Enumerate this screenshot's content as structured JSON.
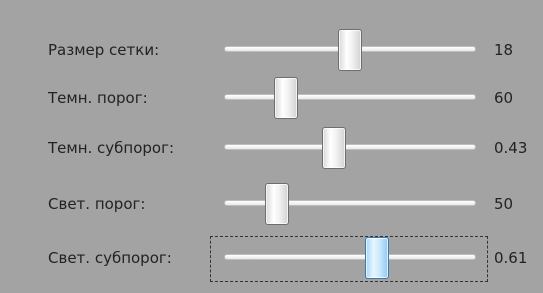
{
  "sliders": [
    {
      "label": "Размер сетки:",
      "value": "18",
      "position": 0.5,
      "focused": false
    },
    {
      "label": "Темн. порог:",
      "value": "60",
      "position": 0.22,
      "focused": false
    },
    {
      "label": "Темн. субпорог:",
      "value": "0.43",
      "position": 0.43,
      "focused": false
    },
    {
      "label": "Свет. порог:",
      "value": "50",
      "position": 0.18,
      "focused": false
    },
    {
      "label": "Свет. субпорог:",
      "value": "0.61",
      "position": 0.62,
      "focused": true
    }
  ],
  "colors": {
    "background": "#a3a3a3",
    "focused_thumb": "#cdeafd"
  }
}
